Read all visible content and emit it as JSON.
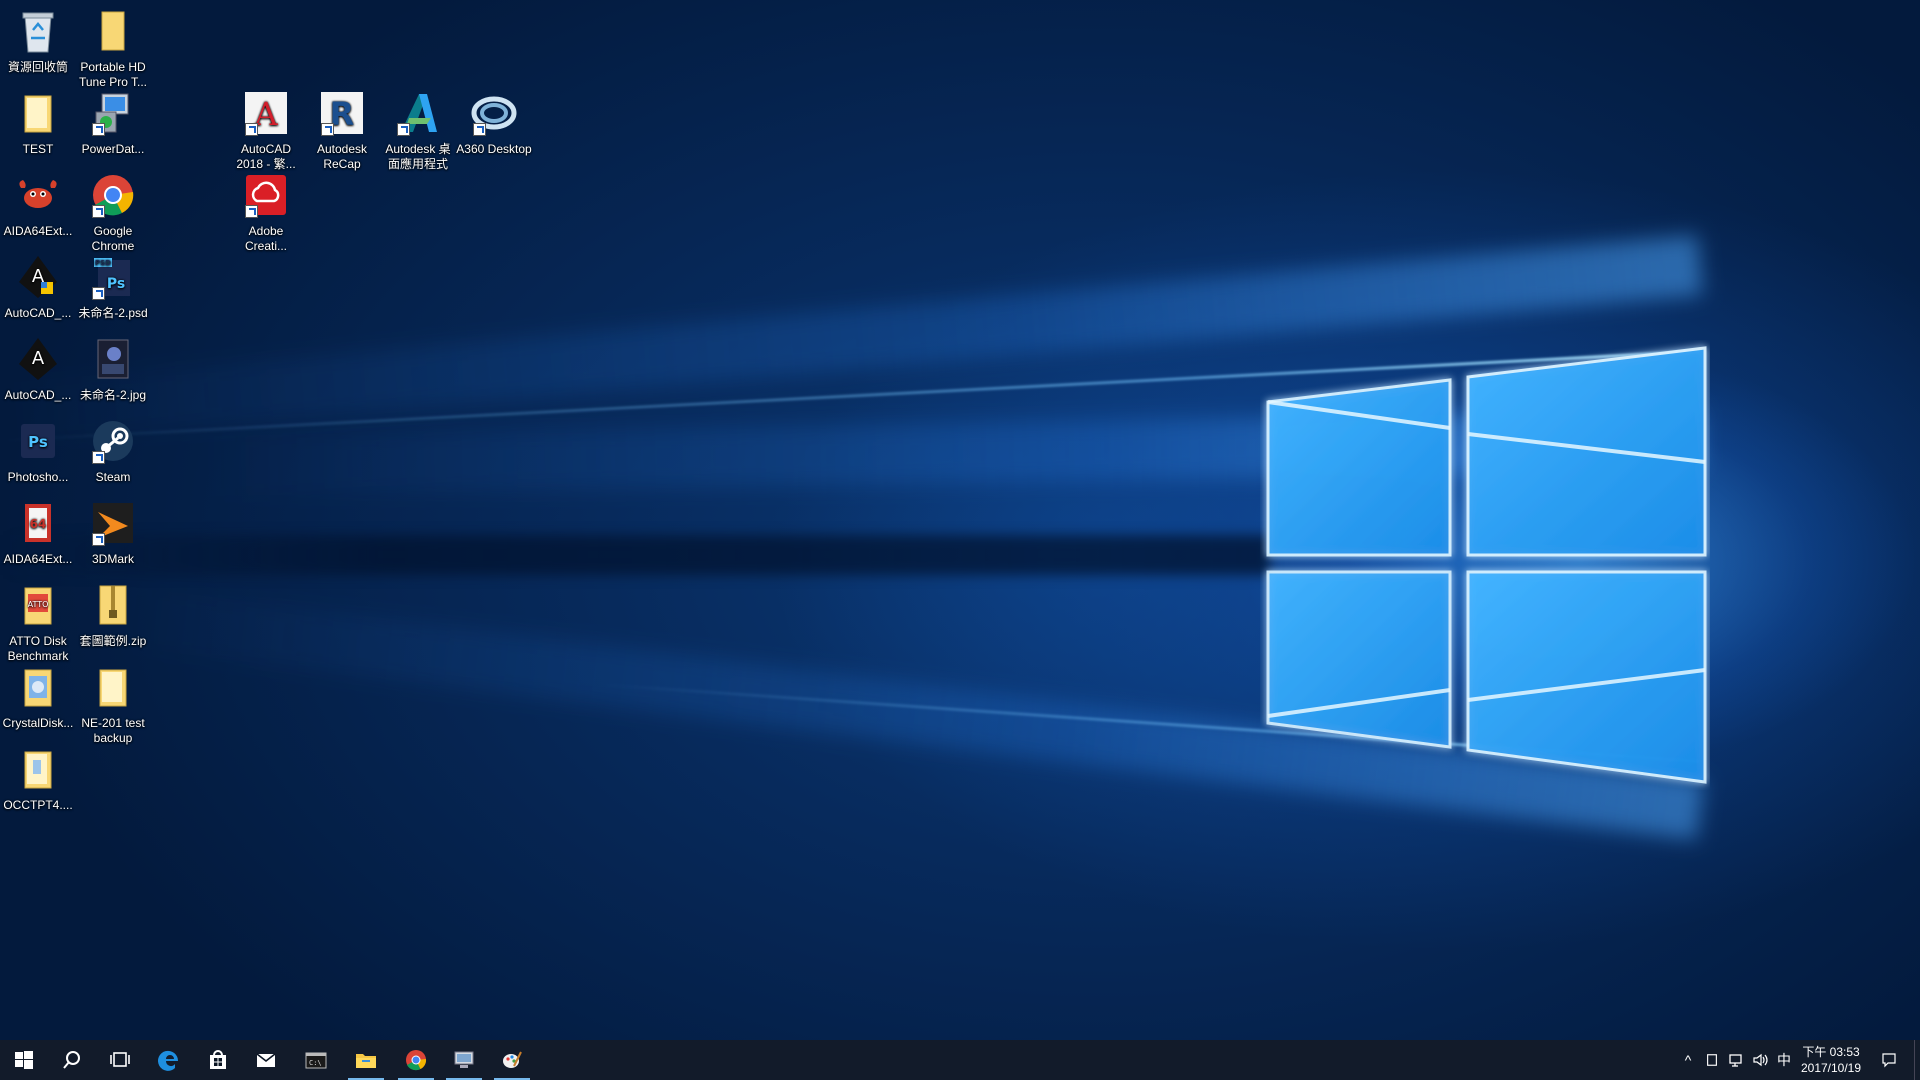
{
  "desktop": {
    "icons": [
      {
        "label": "資源回收筒",
        "icon": "recycle-bin-icon"
      },
      {
        "label": "Portable HD Tune Pro T...",
        "icon": "folder-icon"
      },
      {
        "label": "TEST",
        "icon": "folder-icon"
      },
      {
        "label": "PowerDat...",
        "icon": "powerdata-icon"
      },
      {
        "label": "AutoCAD 2018 - 繁...",
        "icon": "autocad-icon"
      },
      {
        "label": "Autodesk ReCap",
        "icon": "recap-icon"
      },
      {
        "label": "Autodesk 桌面應用程式",
        "icon": "autodesk-icon"
      },
      {
        "label": "A360 Desktop",
        "icon": "a360-icon"
      },
      {
        "label": "AIDA64Ext...",
        "icon": "aida64-crab-icon"
      },
      {
        "label": "Google Chrome",
        "icon": "chrome-icon"
      },
      {
        "label": "Adobe Creati...",
        "icon": "creative-cloud-icon"
      },
      {
        "label": "AutoCAD_...",
        "icon": "autocad-installer-icon"
      },
      {
        "label": "未命名-2.psd",
        "icon": "psd-file-icon"
      },
      {
        "label": "AutoCAD_...",
        "icon": "autocad-black-icon"
      },
      {
        "label": "未命名-2.jpg",
        "icon": "jpg-file-icon"
      },
      {
        "label": "Photosho...",
        "icon": "photoshop-icon"
      },
      {
        "label": "Steam",
        "icon": "steam-icon"
      },
      {
        "label": "AIDA64Ext...",
        "icon": "aida64-book-icon"
      },
      {
        "label": "3DMark",
        "icon": "3dmark-icon"
      },
      {
        "label": "ATTO Disk Benchmark",
        "icon": "atto-icon"
      },
      {
        "label": "套圖範例.zip",
        "icon": "zip-folder-icon"
      },
      {
        "label": "CrystalDisk...",
        "icon": "crystaldisk-icon"
      },
      {
        "label": "NE-201 test backup",
        "icon": "folder-icon"
      },
      {
        "label": "OCCTPT4....",
        "icon": "folder-icon"
      }
    ]
  },
  "taskbar": {
    "buttons": [
      "start-icon",
      "search-icon",
      "task-view-icon",
      "edge-icon",
      "store-icon",
      "mail-icon",
      "terminal-icon",
      "file-explorer-icon",
      "chrome-icon",
      "remote-desktop-icon",
      "paint-icon"
    ],
    "tray": {
      "chevron": "^",
      "ime": "中",
      "time": "下午 03:53",
      "date": "2017/10/19"
    }
  },
  "colors": {
    "accent": "#76b9ed",
    "logo_blue": "#3aa2f5",
    "taskbar": "#0a1423"
  }
}
